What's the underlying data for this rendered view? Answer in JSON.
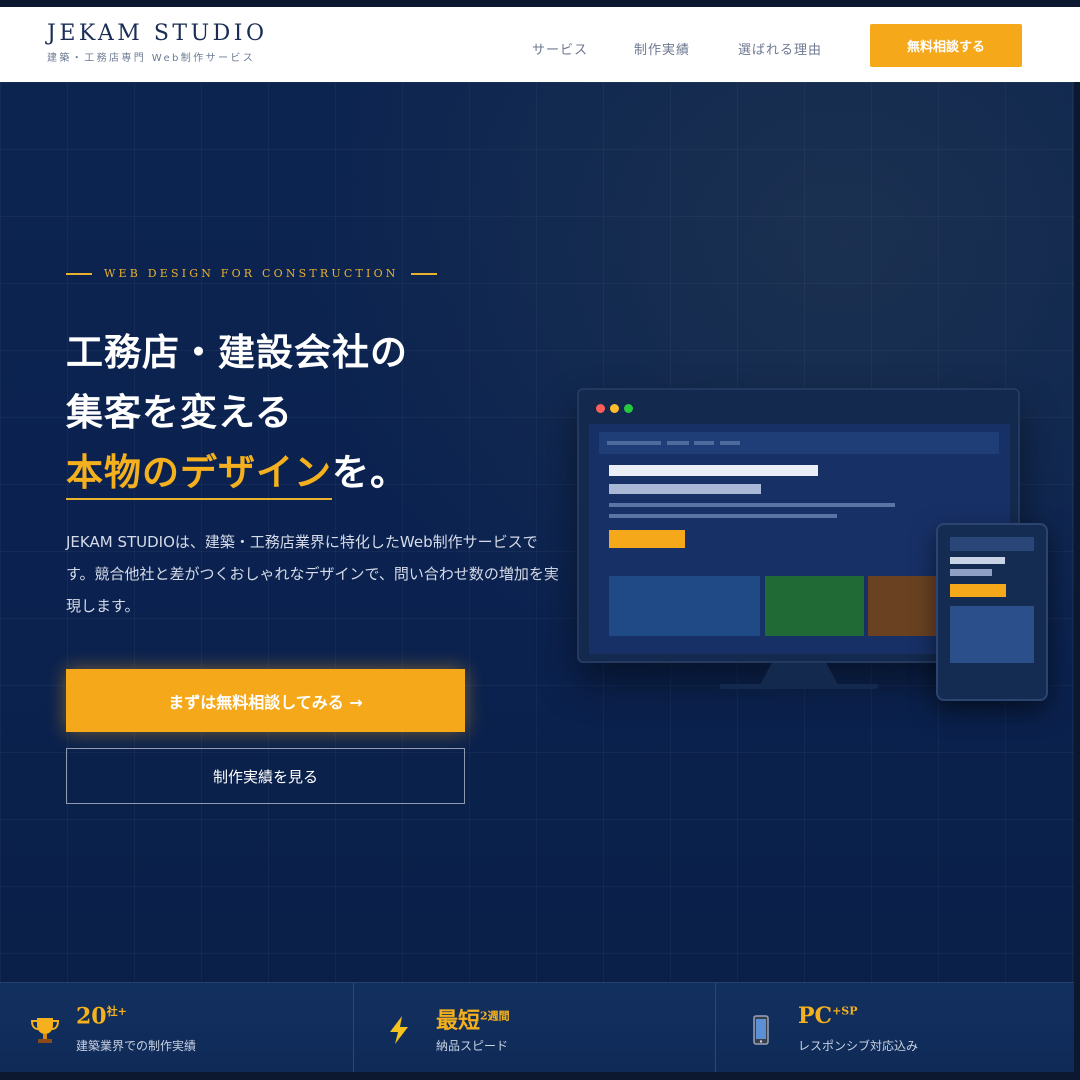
{
  "header": {
    "logo_title": "JEKAM STUDIO",
    "logo_sub": "建築・工務店専門 Web制作サービス",
    "nav": [
      "サービス",
      "制作実績",
      "選ばれる理由"
    ],
    "cta": "無料相談する"
  },
  "hero": {
    "tagline": "WEB DESIGN FOR CONSTRUCTION",
    "headline_line1": "工務店・建設会社の",
    "headline_line2": "集客を変える",
    "headline_accent": "本物のデザイン",
    "headline_tail": "を。",
    "description": "JEKAM STUDIOは、建築・工務店業界に特化したWeb制作サービスです。競合他社と差がつくおしゃれなデザインで、問い合わせ数の増加を実現します。",
    "primary_button": "まずは無料相談してみる →",
    "secondary_button": "制作実績を見る"
  },
  "mockup": {
    "window_dots": [
      "#ff5f56",
      "#ffbd2e",
      "#27c93f"
    ],
    "accent_color": "#f5a81a",
    "tile_colors": [
      "#1f4a86",
      "#1f6a35",
      "#6a4222"
    ]
  },
  "stats": [
    {
      "icon": "trophy-icon",
      "value": "20",
      "unit": "社+",
      "label": "建築業界での制作実績"
    },
    {
      "icon": "lightning-icon",
      "value": "最短",
      "unit": "2週間",
      "label": "納品スピード"
    },
    {
      "icon": "smartphone-icon",
      "value": "PC",
      "unit": "+SP",
      "label": "レスポンシブ対応込み"
    }
  ],
  "colors": {
    "navy": "#0b2250",
    "gold": "#f5a81a",
    "white": "#ffffff"
  }
}
